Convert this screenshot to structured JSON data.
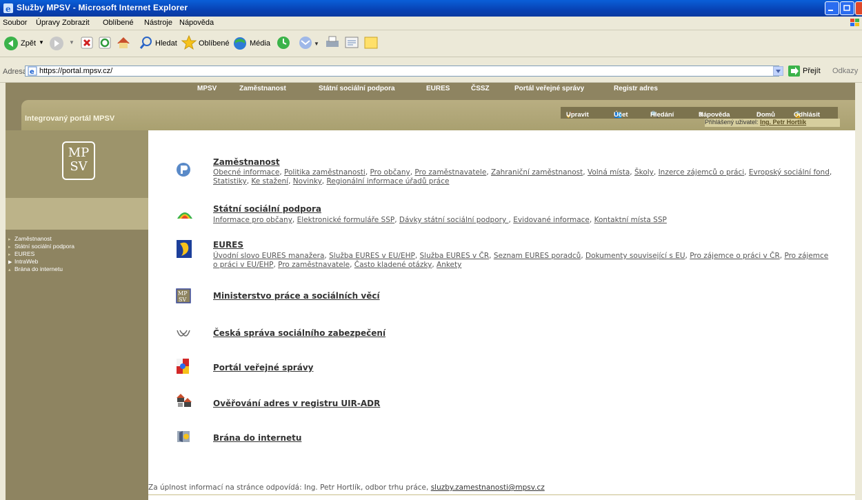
{
  "window": {
    "title": "Služby MPSV - Microsoft Internet Explorer"
  },
  "menubar": [
    "Soubor",
    "Úpravy",
    "Zobrazit",
    "Oblíbené",
    "Nástroje",
    "Nápověda"
  ],
  "toolbar": {
    "back": "Zpět",
    "search": "Hledat",
    "favorites": "Oblíbené",
    "media": "Média"
  },
  "address": {
    "label": "Adresa",
    "url": "https://portal.mpsv.cz/",
    "go": "Přejít",
    "links": "Odkazy"
  },
  "topnav": [
    "MPSV",
    "Zaměstnanost",
    "Státní sociální podpora",
    "EURES",
    "ČSSZ",
    "Portál veřejné správy",
    "Registr adres"
  ],
  "header": {
    "portal_title": "Integrovaný portál MPSV",
    "actions": [
      "Upravit",
      "Účet",
      "Hledání",
      "Nápověda",
      "Domů",
      "Odhlásit"
    ],
    "user_label": "Přihlášený uživatel:",
    "user_name": "Ing. Petr Hortlík"
  },
  "logo": {
    "line1": "MP",
    "line2": "SV"
  },
  "leftnav": [
    "Zaměstnanost",
    "Státní sociální podpora",
    "EURES",
    "IntraWeb",
    "Brána do internetu"
  ],
  "sections": [
    {
      "title": "Zaměstnanost",
      "links": [
        "Obecné informace",
        "Politika zaměstnanosti",
        "Pro občany",
        "Pro zaměstnavatele",
        "Zahraniční zaměstnanost",
        "Volná místa",
        "Školy",
        "Inzerce zájemců o práci",
        "Evropský sociální fond",
        "Statistiky",
        "Ke stažení",
        "Novinky",
        "Regionální informace úřadů práce"
      ]
    },
    {
      "title": "Státní sociální podpora",
      "links": [
        "Informace pro občany",
        "Elektronické formuláře SSP",
        "Dávky státní sociální podpory ",
        "Evidované informace",
        "Kontaktní místa SSP"
      ]
    },
    {
      "title": "EURES",
      "links": [
        "Úvodní slovo EURES manažera",
        "Služba EURES v EU/EHP",
        "Služba EURES v ČR",
        "Seznam EURES poradců",
        "Dokumenty související s EU",
        "Pro zájemce o práci v ČR",
        "Pro zájemce o práci v EU/EHP",
        "Pro zaměstnavatele",
        "Často kladené otázky",
        "Ankety"
      ]
    },
    {
      "title": "Ministerstvo práce a sociálních věcí",
      "links": []
    },
    {
      "title": "Česká správa sociálního zabezpečení",
      "links": []
    },
    {
      "title": "Portál veřejné správy",
      "links": []
    },
    {
      "title": "Ověřování adres v registru UIR-ADR",
      "links": []
    },
    {
      "title": "Brána do internetu",
      "links": []
    }
  ],
  "footer": {
    "text": "Za úplnost informací na stránce odpovídá: Ing. Petr Hortlík, odbor trhu práce, ",
    "email": "sluzby.zamestnanosti@mpsv.cz"
  }
}
